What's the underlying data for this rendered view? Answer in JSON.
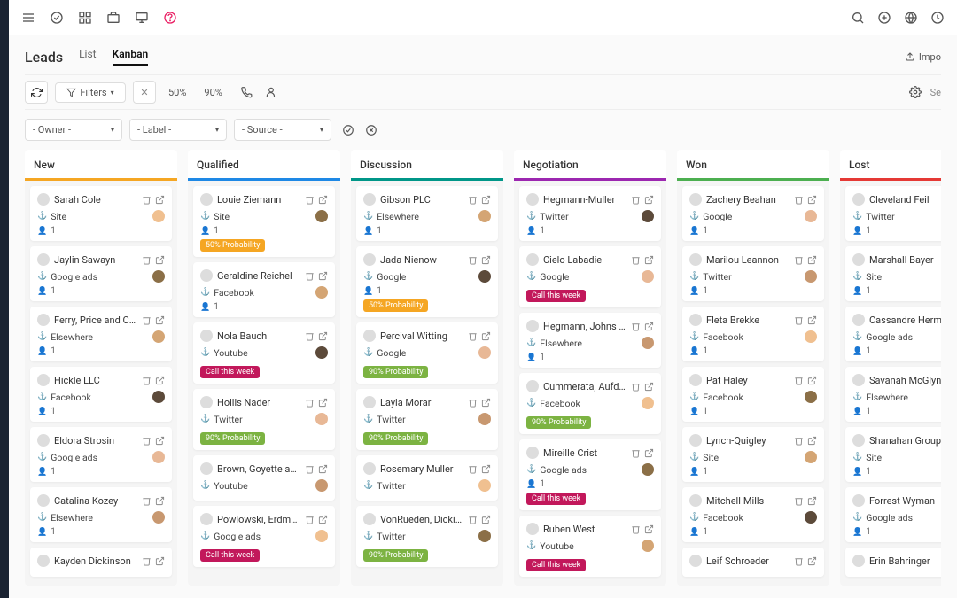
{
  "page_title": "Leads",
  "tabs": [
    "List",
    "Kanban"
  ],
  "active_tab": "Kanban",
  "import_label": "Impo",
  "filters_label": "Filters",
  "pct_50": "50%",
  "pct_90": "90%",
  "search_placeholder": "Se",
  "selects": {
    "owner": "- Owner -",
    "label": "- Label -",
    "source": "- Source -"
  },
  "columns": [
    {
      "name": "New",
      "color": "#f5a623",
      "cards": [
        {
          "name": "Sarah Cole",
          "source": "Site",
          "count": "1"
        },
        {
          "name": "Jaylin Sawayn",
          "source": "Google ads",
          "count": "1"
        },
        {
          "name": "Ferry, Price and Carter",
          "source": "Elsewhere",
          "count": "1"
        },
        {
          "name": "Hickle LLC",
          "source": "Facebook",
          "count": "1"
        },
        {
          "name": "Eldora Strosin",
          "source": "Google ads",
          "count": "1"
        },
        {
          "name": "Catalina Kozey",
          "source": "Elsewhere",
          "count": "1"
        },
        {
          "name": "Kayden Dickinson",
          "source": "",
          "count": ""
        }
      ]
    },
    {
      "name": "Qualified",
      "color": "#1e88e5",
      "cards": [
        {
          "name": "Louie Ziemann",
          "source": "Site",
          "count": "1",
          "badge": "50% Probability",
          "badgeColor": "orange"
        },
        {
          "name": "Geraldine Reichel",
          "source": "Facebook",
          "count": "1"
        },
        {
          "name": "Nola Bauch",
          "source": "Youtube",
          "count": "",
          "badge": "Call this week",
          "badgeColor": "magenta"
        },
        {
          "name": "Hollis Nader",
          "source": "Twitter",
          "count": "",
          "badge": "90% Probability",
          "badgeColor": "green"
        },
        {
          "name": "Brown, Goyette and Gusikowski",
          "source": "Youtube",
          "count": ""
        },
        {
          "name": "Powlowski, Erdman and Wilderman",
          "source": "Google ads",
          "count": "",
          "badge": "Call this week",
          "badgeColor": "magenta"
        }
      ]
    },
    {
      "name": "Discussion",
      "color": "#009688",
      "cards": [
        {
          "name": "Gibson PLC",
          "source": "Elsewhere",
          "count": "1"
        },
        {
          "name": "Jada Nienow",
          "source": "Google",
          "count": "1",
          "badge": "50% Probability",
          "badgeColor": "orange"
        },
        {
          "name": "Percival Witting",
          "source": "Google",
          "count": "",
          "badge": "90% Probability",
          "badgeColor": "green"
        },
        {
          "name": "Layla Morar",
          "source": "Twitter",
          "count": "",
          "badge": "90% Probability",
          "badgeColor": "green"
        },
        {
          "name": "Rosemary Muller",
          "source": "Twitter",
          "count": ""
        },
        {
          "name": "VonRueden, Dickinson and Macejkovic",
          "source": "Twitter",
          "count": "",
          "badge": "90% Probability",
          "badgeColor": "green"
        }
      ]
    },
    {
      "name": "Negotiation",
      "color": "#9c27b0",
      "cards": [
        {
          "name": "Hegmann-Muller",
          "source": "Twitter",
          "count": "1"
        },
        {
          "name": "Cielo Labadie",
          "source": "Google",
          "count": "",
          "badge": "Call this week",
          "badgeColor": "magenta"
        },
        {
          "name": "Hegmann, Johns and Ankunding",
          "source": "Elsewhere",
          "count": "1"
        },
        {
          "name": "Cummerata, Aufderhar and Bergnaum",
          "source": "Facebook",
          "count": "",
          "badge": "90% Probability",
          "badgeColor": "green"
        },
        {
          "name": "Mireille Crist",
          "source": "Google ads",
          "count": "1",
          "badge": "Call this week",
          "badgeColor": "magenta"
        },
        {
          "name": "Ruben West",
          "source": "Youtube",
          "count": "",
          "badge": "Call this week",
          "badgeColor": "magenta"
        }
      ]
    },
    {
      "name": "Won",
      "color": "#4caf50",
      "cards": [
        {
          "name": "Zachery Beahan",
          "source": "Google",
          "count": "1"
        },
        {
          "name": "Marilou Leannon",
          "source": "Twitter",
          "count": "1"
        },
        {
          "name": "Fleta Brekke",
          "source": "Facebook",
          "count": "1"
        },
        {
          "name": "Pat Haley",
          "source": "Facebook",
          "count": "1"
        },
        {
          "name": "Lynch-Quigley",
          "source": "Site",
          "count": "1"
        },
        {
          "name": "Mitchell-Mills",
          "source": "Facebook",
          "count": "1"
        },
        {
          "name": "Leif Schroeder",
          "source": "",
          "count": ""
        }
      ]
    },
    {
      "name": "Lost",
      "color": "#e53935",
      "cards": [
        {
          "name": "Cleveland Feil",
          "source": "Twitter",
          "count": "1"
        },
        {
          "name": "Marshall Bayer",
          "source": "Site",
          "count": "1"
        },
        {
          "name": "Cassandre Herman",
          "source": "Google ads",
          "count": "1"
        },
        {
          "name": "Savanah McGlynn",
          "source": "Elsewhere",
          "count": "1"
        },
        {
          "name": "Shanahan Group",
          "source": "Site",
          "count": "1"
        },
        {
          "name": "Forrest Wyman",
          "source": "Google ads",
          "count": "1"
        },
        {
          "name": "Erin Bahringer",
          "source": "",
          "count": ""
        }
      ]
    }
  ]
}
